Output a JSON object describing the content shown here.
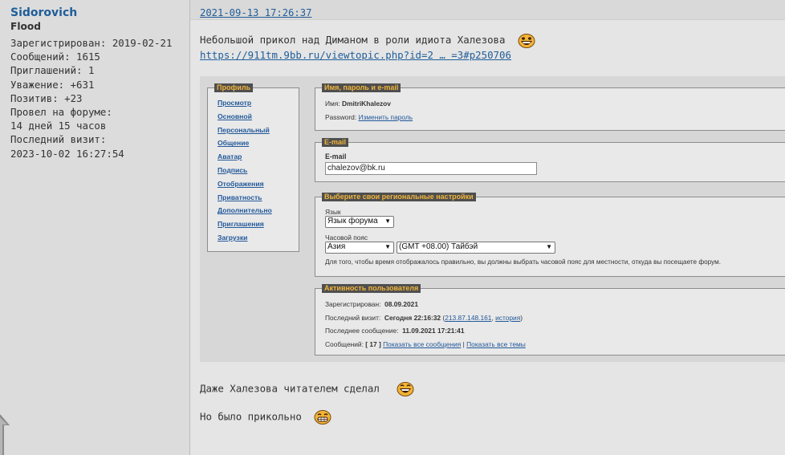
{
  "author": {
    "name": "Sidorovich",
    "rank": "Flood",
    "stats": [
      "Зарегистрирован: 2019-02-21",
      "Сообщений: 1615",
      "Приглашений: 1",
      "Уважение: +631",
      "Позитив: +23",
      "Провел на форуме:",
      "14 дней 15 часов",
      "Последний визит:",
      "2023-10-02 16:27:54"
    ]
  },
  "post": {
    "date": "2021-09-13 17:26:37",
    "line1": "Небольшой прикол над Диманом в роли идиота Халезова",
    "link": "https://911tm.9bb.ru/viewtopic.php?id=2 … =3#p250706",
    "line3": "Даже Халезова читателем сделал",
    "line4": "Но было прикольно"
  },
  "screenshot": {
    "menu_legend": "Профиль",
    "menu_items": [
      "Просмотр",
      "Основной",
      "Персональный",
      "Общение",
      "Аватар",
      "Подпись",
      "Отображения",
      "Приватность",
      "Дополнительно",
      "Приглашения",
      "Загрузки"
    ],
    "name_legend": "Имя, пароль и e-mail",
    "name_label": "Имя:",
    "name_value": "DmitriKhalezov",
    "password_label": "Password:",
    "password_link": "Изменить пароль",
    "email_legend": "E-mail",
    "email_label": "E-mail",
    "email_value": "chalezov@bk.ru",
    "regional_legend": "Выберите свои региональные настройки",
    "lang_label": "Язык",
    "lang_value": "Язык форума",
    "tz_label": "Часовой пояс",
    "tz_region": "Азия",
    "tz_value": "(GMT +08.00) Тайбэй",
    "tz_hint": "Для того, чтобы время отображалось правильно, вы должны выбрать часовой пояс для местности, откуда вы посещаете форум.",
    "activity_legend": "Активность пользователя",
    "reg_label": "Зарегистрирован:",
    "reg_value": "08.09.2021",
    "last_visit_label": "Последний визит:",
    "last_visit_value": "Сегодня 22:16:32",
    "last_visit_ip": "213.87.148.161",
    "last_visit_history": "история",
    "last_post_label": "Последнее сообщение:",
    "last_post_value": "11.09.2021 17:21:41",
    "posts_label": "Сообщений:",
    "posts_value": "[ 17 ]",
    "show_posts": "Показать все сообщения",
    "show_topics": "Показать все темы"
  },
  "colors": {
    "username": "#1f5d99",
    "link": "#1f5d99",
    "legend_text": "#f0b43c",
    "legend_bg": "#4f4f4f"
  },
  "icons": [
    "laughing-smiley-icon",
    "grinning-smiley-icon"
  ]
}
